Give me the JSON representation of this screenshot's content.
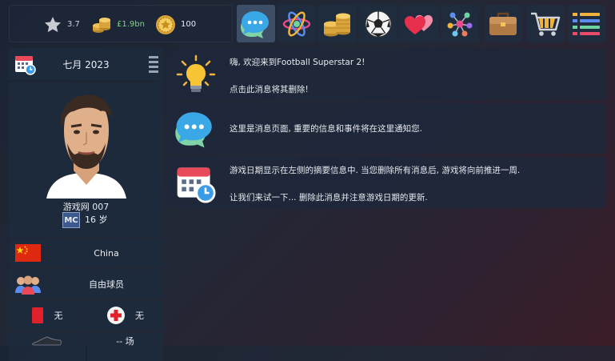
{
  "stats": {
    "rating": "3.7",
    "money": "£1.9bn",
    "fame": "100",
    "money_color": "#7fd67f"
  },
  "toolbar": {
    "items": [
      {
        "icon": "chat-bubbles-icon",
        "active": true
      },
      {
        "icon": "atom-icon",
        "active": false
      },
      {
        "icon": "coin-stack-icon",
        "active": false
      },
      {
        "icon": "soccer-ball-icon",
        "active": false
      },
      {
        "icon": "hearts-icon",
        "active": false
      },
      {
        "icon": "network-icon",
        "active": false
      },
      {
        "icon": "briefcase-icon",
        "active": false
      },
      {
        "icon": "shopping-cart-icon",
        "active": false
      },
      {
        "icon": "menu-list-icon",
        "active": false
      }
    ]
  },
  "date": {
    "label": "七月 2023"
  },
  "player": {
    "name": "游戏网 007",
    "position": "MC",
    "age": "16 岁",
    "nation": "China",
    "club": "自由球员",
    "red_cards": "无",
    "injury": "无",
    "games": "-- 场"
  },
  "messages": [
    {
      "icon": "lightbulb-icon",
      "lines": [
        "嗨, 欢迎来到Football Superstar 2!",
        "点击此消息将其删除!"
      ]
    },
    {
      "icon": "chat-bubbles-icon",
      "lines": [
        "这里是消息页面, 重要的信息和事件将在这里通知您."
      ]
    },
    {
      "icon": "calendar-icon",
      "lines": [
        "游戏日期显示在左侧的摘要信息中. 当您删除所有消息后, 游戏将向前推进一周.",
        "让我们来试一下... 删除此消息并注意游戏日期的更新."
      ]
    }
  ]
}
